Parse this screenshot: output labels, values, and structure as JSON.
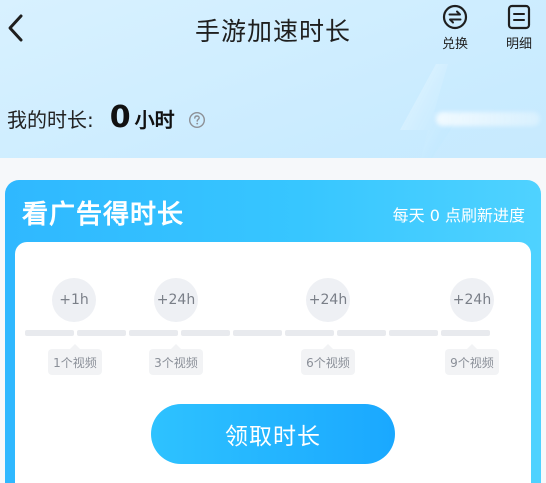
{
  "header": {
    "title": "手游加速时长",
    "back_icon": "chevron-left-icon",
    "exchange": {
      "label": "兑换",
      "icon": "exchange-icon"
    },
    "detail": {
      "label": "明细",
      "icon": "list-icon"
    }
  },
  "duration": {
    "label": "我的时长:",
    "value": "0",
    "unit": "小时",
    "help_icon": "question-circle-icon"
  },
  "ad_card": {
    "title": "看广告得时长",
    "reset_note": "每天 0 点刷新进度",
    "milestones": [
      {
        "reward": "+1h",
        "videos": "1个视频"
      },
      {
        "reward": "+24h",
        "videos": "3个视频"
      },
      {
        "reward": "+24h",
        "videos": "6个视频"
      },
      {
        "reward": "+24h",
        "videos": "9个视频"
      }
    ],
    "progress_fraction": 0,
    "claim_button": "领取时长"
  },
  "colors": {
    "accent": "#2fb8ff",
    "button": "#1aa8ff",
    "track": "#e8eaee",
    "page_bg": "#c9ebff"
  }
}
